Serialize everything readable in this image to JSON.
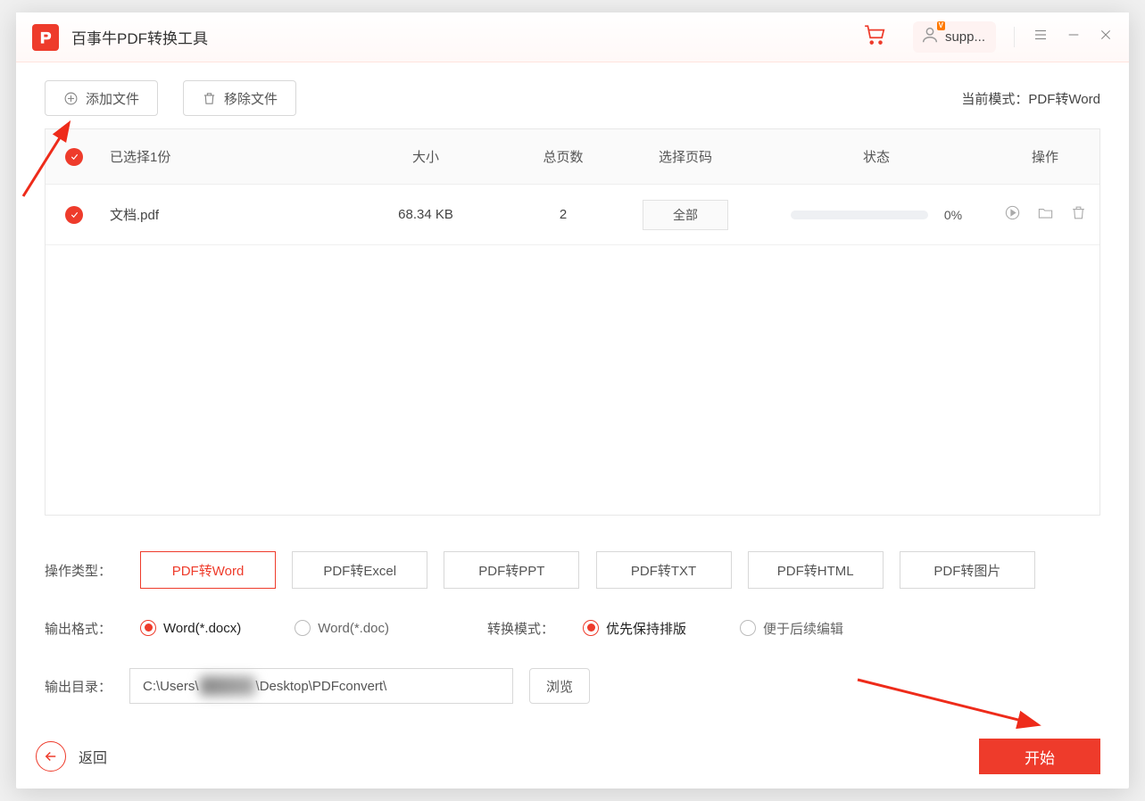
{
  "titlebar": {
    "app_title": "百事牛PDF转换工具",
    "user_name": "supp..."
  },
  "toolbar": {
    "add_file_label": "添加文件",
    "remove_file_label": "移除文件",
    "mode_prefix": "当前模式：",
    "mode_value": "PDF转Word"
  },
  "table": {
    "headers": {
      "selected": "已选择1份",
      "size": "大小",
      "pages": "总页数",
      "select_pages": "选择页码",
      "status": "状态",
      "actions": "操作"
    },
    "rows": [
      {
        "filename": "文档.pdf",
        "size": "68.34 KB",
        "pages": "2",
        "select_label": "全部",
        "progress_pct": "0%"
      }
    ]
  },
  "options": {
    "type_label": "操作类型：",
    "types": [
      "PDF转Word",
      "PDF转Excel",
      "PDF转PPT",
      "PDF转TXT",
      "PDF转HTML",
      "PDF转图片"
    ],
    "format_label": "输出格式：",
    "formats": [
      "Word(*.docx)",
      "Word(*.doc)"
    ],
    "mode_label": "转换模式：",
    "modes": [
      "优先保持排版",
      "便于后续编辑"
    ],
    "output_label": "输出目录：",
    "path_prefix": "C:\\Users\\",
    "path_suffix": "\\Desktop\\PDFconvert\\",
    "browse_label": "浏览"
  },
  "footer": {
    "back_label": "返回",
    "start_label": "开始"
  }
}
